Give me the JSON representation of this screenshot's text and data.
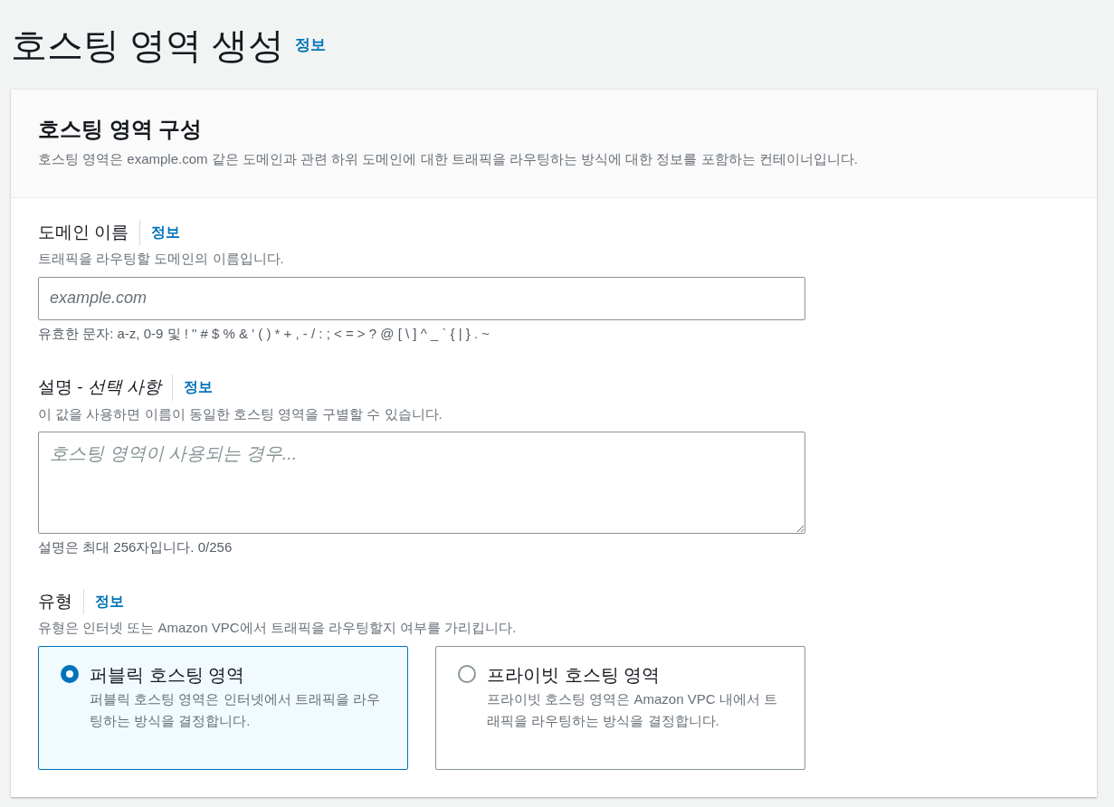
{
  "page": {
    "title": "호스팅 영역 생성",
    "info_link": "정보"
  },
  "card": {
    "title": "호스팅 영역 구성",
    "description": "호스팅 영역은 example.com 같은 도메인과 관련 하위 도메인에 대한 트래픽을 라우팅하는 방식에 대한 정보를 포함하는 컨테이너입니다."
  },
  "domain_name": {
    "label": "도메인 이름",
    "info_link": "정보",
    "description": "트래픽을 라우팅할 도메인의 이름입니다.",
    "placeholder": "example.com",
    "constraint": "유효한 문자: a-z, 0-9 및 ! \" # $ % & ' ( ) * + , - / : ; < = > ? @ [ \\ ] ^ _ ` { | } . ~"
  },
  "description_field": {
    "label": "설명 - *선택 사항*",
    "info_link": "정보",
    "description": "이 값을 사용하면 이름이 동일한 호스팅 영역을 구별할 수 있습니다.",
    "placeholder": "호스팅 영역이 사용되는 경우...",
    "constraint": "설명은 최대 256자입니다. 0/256"
  },
  "type": {
    "label": "유형",
    "info_link": "정보",
    "description": "유형은 인터넷 또는 Amazon VPC에서 트래픽을 라우팅할지 여부를 가리킵니다.",
    "options": [
      {
        "label": "퍼블릭 호스팅 영역",
        "description": "퍼블릭 호스팅 영역은 인터넷에서 트래픽을 라우팅하는 방식을 결정합니다.",
        "selected": true
      },
      {
        "label": "프라이빗 호스팅 영역",
        "description": "프라이빗 호스팅 영역은 Amazon VPC 내에서 트래픽을 라우팅하는 방식을 결정합니다.",
        "selected": false
      }
    ]
  }
}
